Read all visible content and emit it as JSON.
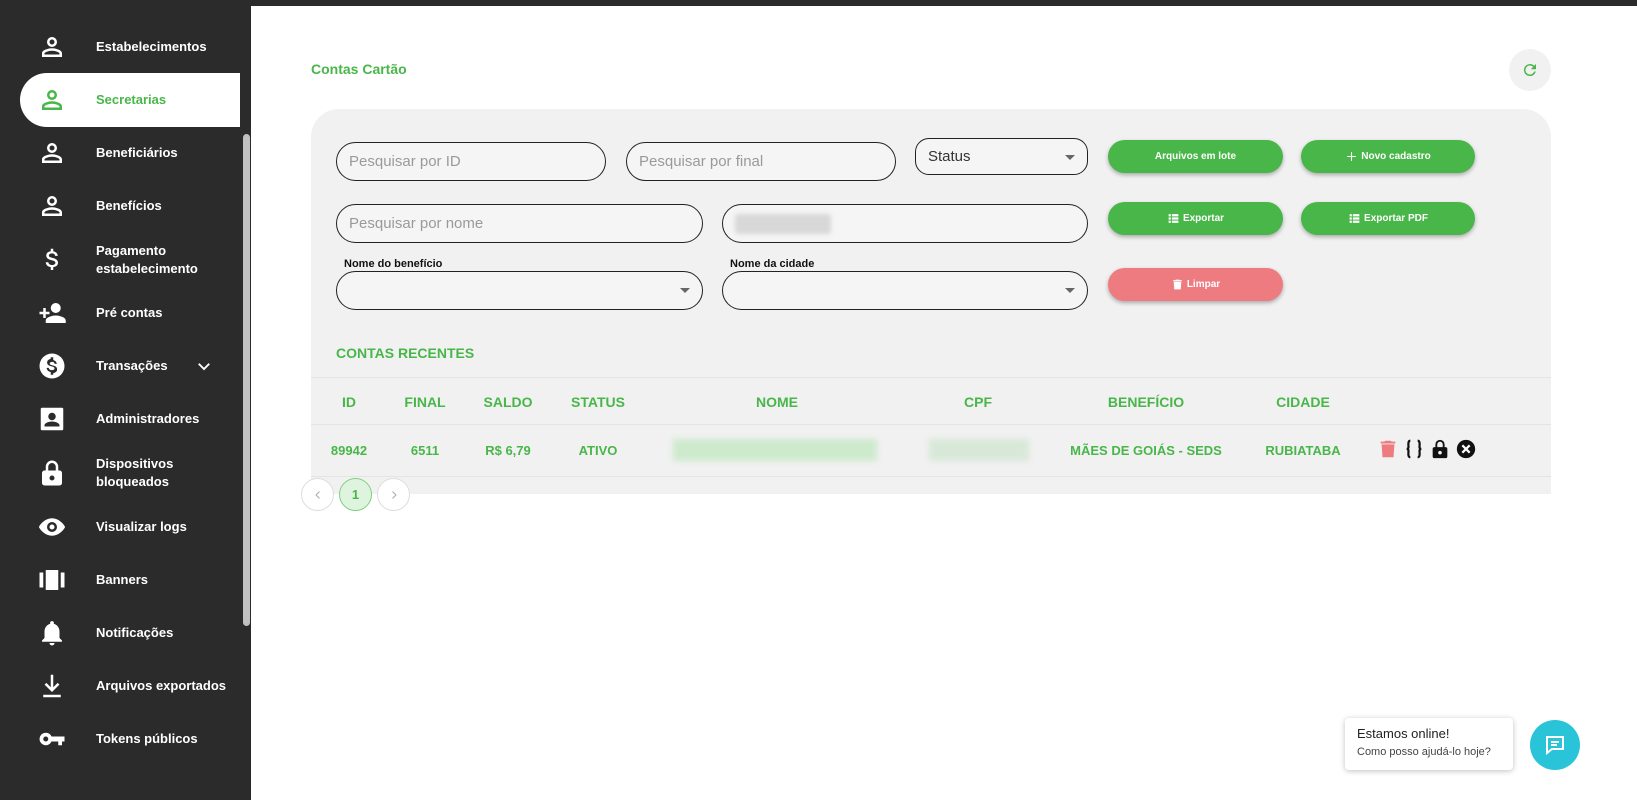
{
  "sidebar": {
    "items": [
      {
        "label": "Estabelecimentos",
        "icon": "person-icon"
      },
      {
        "label": "Secretarias",
        "icon": "person-icon",
        "active": true
      },
      {
        "label": "Beneficiários",
        "icon": "person-icon"
      },
      {
        "label": "Benefícios",
        "icon": "person-icon"
      },
      {
        "label": "Pagamento estabelecimento",
        "icon": "dollar-icon"
      },
      {
        "label": "Pré contas",
        "icon": "person-add-icon"
      },
      {
        "label": "Transações",
        "icon": "dollar-circle-icon"
      },
      {
        "label": "Administradores",
        "icon": "badge-icon"
      },
      {
        "label": "Dispositivos bloqueados",
        "icon": "lock-icon"
      },
      {
        "label": "Visualizar logs",
        "icon": "eye-icon"
      },
      {
        "label": "Banners",
        "icon": "banners-icon"
      },
      {
        "label": "Notificações",
        "icon": "bell-icon"
      },
      {
        "label": "Arquivos exportados",
        "icon": "download-icon"
      },
      {
        "label": "Tokens públicos",
        "icon": "key-icon"
      }
    ]
  },
  "page": {
    "title": "Contas Cartão"
  },
  "filters": {
    "search_id_placeholder": "Pesquisar por ID",
    "search_final_placeholder": "Pesquisar por final",
    "status_value": "Status",
    "search_name_placeholder": "Pesquisar por nome",
    "benefit_label": "Nome do benefício",
    "city_label": "Nome da cidade"
  },
  "buttons": {
    "batch_files": "Arquivos em lote",
    "new_register": "Novo cadastro",
    "export": "Exportar",
    "export_pdf": "Exportar PDF",
    "clear": "Limpar"
  },
  "table": {
    "section_title": "CONTAS RECENTES",
    "headers": [
      "ID",
      "FINAL",
      "SALDO",
      "STATUS",
      "NOME",
      "CPF",
      "BENEFÍCIO",
      "CIDADE"
    ],
    "rows": [
      {
        "id": "89942",
        "final": "6511",
        "saldo": "R$ 6,79",
        "status": "ATIVO",
        "beneficio": "MÃES DE GOIÁS - SEDS",
        "cidade": "RUBIATABA"
      }
    ]
  },
  "pagination": {
    "current": "1"
  },
  "chat": {
    "title": "Estamos online!",
    "subtitle": "Como posso ajudá-lo hoje?"
  },
  "colors": {
    "accent": "#49b649",
    "danger": "#ee7b80",
    "sidebar": "#2b2b2b",
    "chat": "#29c4d8"
  }
}
